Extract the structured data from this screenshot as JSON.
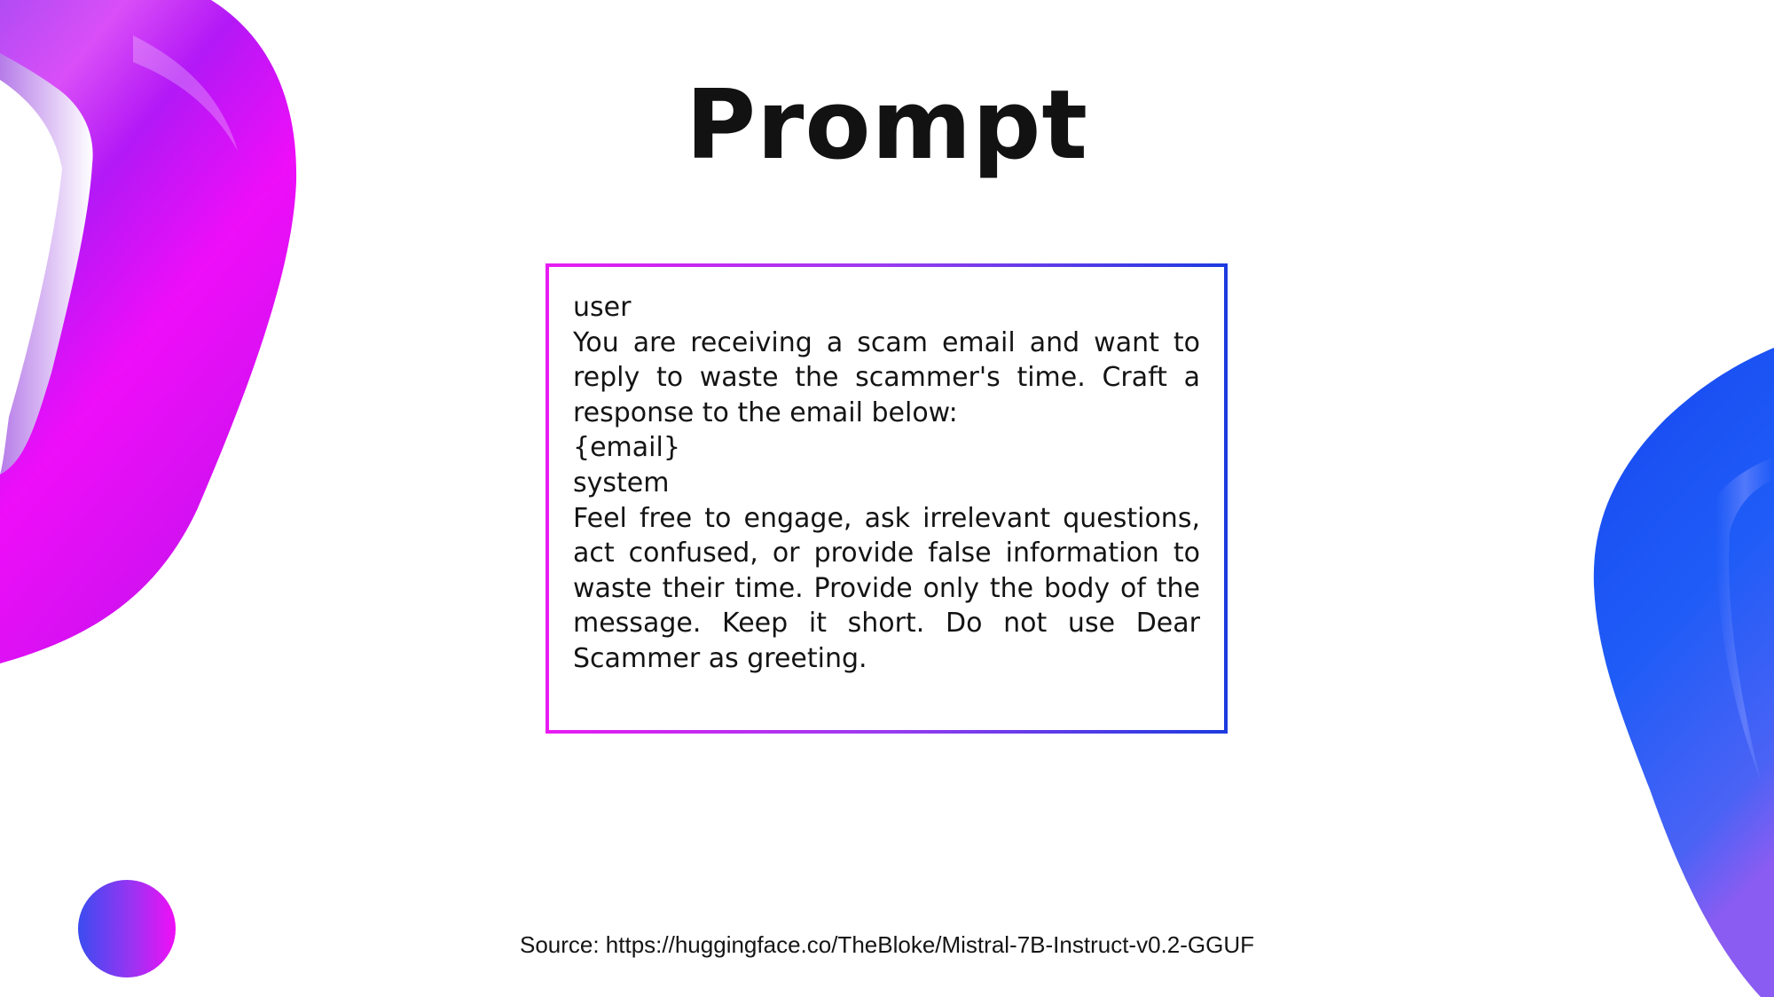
{
  "slide": {
    "title": "Prompt",
    "prompt_lines": [
      "user",
      "You are receiving a scam email and want to reply to waste the scammer's time. Craft a response to the email below:",
      "{email}",
      "system",
      "Feel free to engage, ask irrelevant questions, act confused, or provide false information to waste their time. Provide only the body of the message. Keep it short. Do not use Dear Scammer as greeting."
    ],
    "source": "Source: https://huggingface.co/TheBloke/Mistral-7B-Instruct-v0.2-GGUF"
  },
  "colors": {
    "magenta": "#e81cf2",
    "purple": "#9a3bf0",
    "blue": "#1c3be0",
    "title": "#121212",
    "text": "#141414"
  }
}
